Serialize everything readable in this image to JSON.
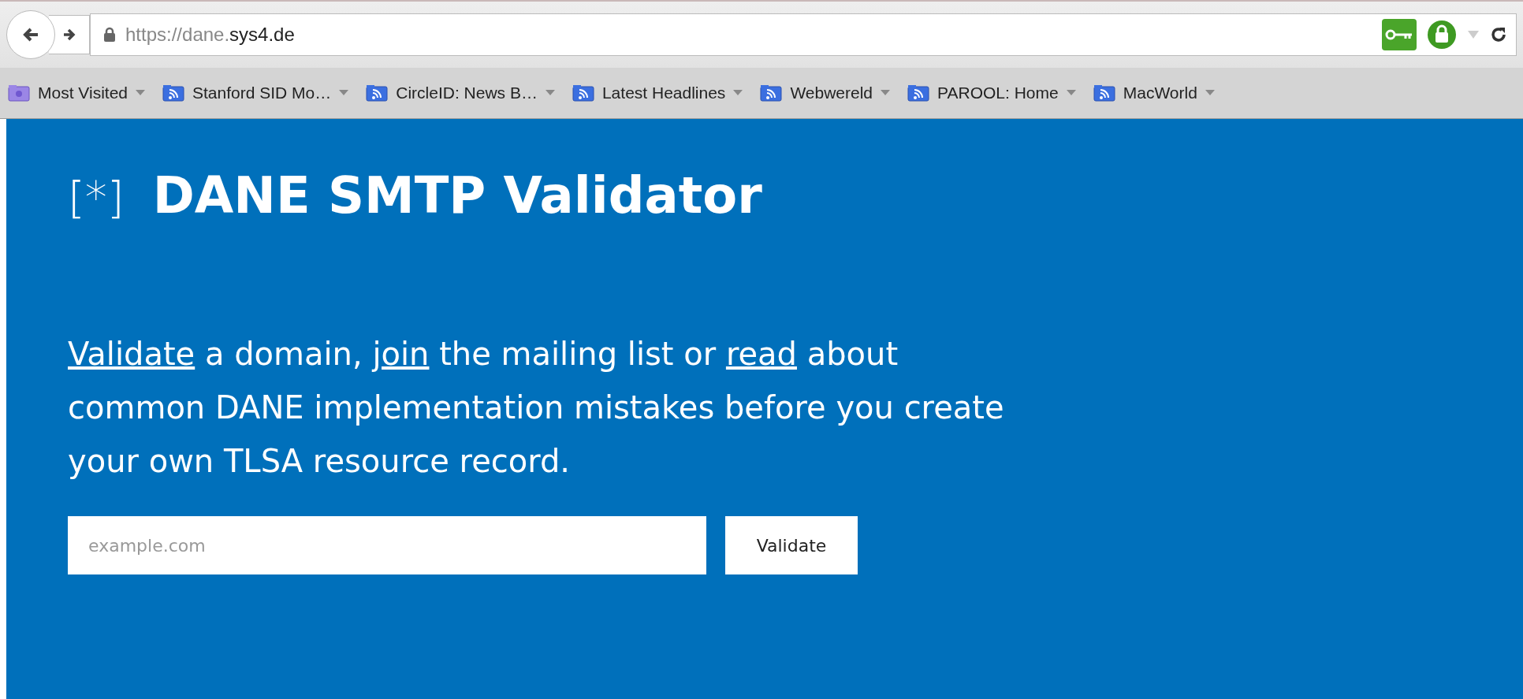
{
  "toolbar": {
    "url_prefix": "https://dane.",
    "url_domain": "sys4.de"
  },
  "bookmarks": [
    {
      "kind": "folder",
      "label": "Most Visited"
    },
    {
      "kind": "feed",
      "label": "Stanford SID Mo…"
    },
    {
      "kind": "feed",
      "label": "CircleID: News B…"
    },
    {
      "kind": "feed",
      "label": "Latest Headlines"
    },
    {
      "kind": "feed",
      "label": "Webwereld"
    },
    {
      "kind": "feed",
      "label": "PAROOL: Home"
    },
    {
      "kind": "feed",
      "label": "MacWorld"
    }
  ],
  "page": {
    "logo": "[*]",
    "title": "DANE SMTP Validator",
    "intro": [
      {
        "kind": "link",
        "text": "Validate"
      },
      {
        "kind": "text",
        "text": " a domain, "
      },
      {
        "kind": "link",
        "text": "join"
      },
      {
        "kind": "text",
        "text": " the mailing list or "
      },
      {
        "kind": "link",
        "text": "read"
      },
      {
        "kind": "text",
        "text": " about common DANE implementation mistakes before you create your own TLSA resource record."
      }
    ],
    "form": {
      "placeholder": "example.com",
      "button": "Validate"
    }
  }
}
